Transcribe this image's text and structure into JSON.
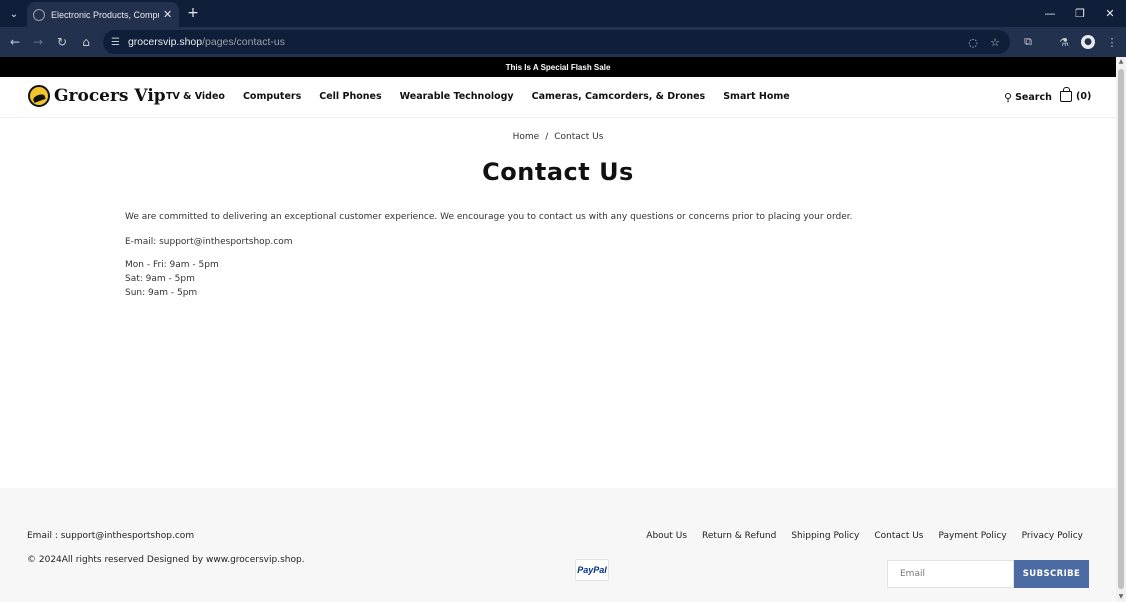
{
  "browser": {
    "tab_title": "Electronic Products, Computers",
    "url_host": "grocersvip.shop",
    "url_path": "/pages/contact-us"
  },
  "announcement": "This Is A Special Flash Sale",
  "header": {
    "logo_text": "Grocers Vip",
    "nav": [
      "TV & Video",
      "Computers",
      "Cell Phones",
      "Wearable Technology",
      "Cameras, Camcorders, & Drones",
      "Smart Home"
    ],
    "search_label": "Search",
    "cart_label": "(0)"
  },
  "breadcrumb": {
    "home": "Home",
    "separator": "/",
    "current": "Contact Us"
  },
  "page": {
    "title": "Contact Us",
    "intro": "We are committed to delivering an exceptional customer experience. We encourage you to contact us with any questions or concerns prior to placing your order.",
    "email_line": "E-mail: support@inthesportshop.com",
    "hours": [
      "Mon - Fri: 9am - 5pm",
      "Sat: 9am - 5pm",
      "Sun: 9am - 5pm"
    ]
  },
  "footer": {
    "email": "Email : support@inthesportshop.com",
    "copyright": "© 2024All rights reserved Designed by www.grocersvip.shop.",
    "links": [
      "About Us",
      "Return & Refund",
      "Shipping Policy",
      "Contact Us",
      "Payment Policy",
      "Privacy Policy"
    ],
    "payment_badge": "PayPal",
    "newsletter_placeholder": "Email",
    "subscribe_label": "SUBSCRIBE"
  }
}
